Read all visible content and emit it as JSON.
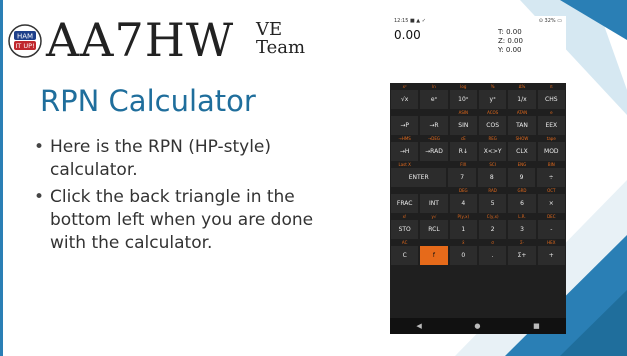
{
  "slide": {
    "brand_main": "AA7HW",
    "brand_sup": "VE",
    "brand_sub": "Team",
    "logo_text_top": "HAM",
    "logo_text_bottom": "IT UP!",
    "title": "RPN Calculator",
    "bullets": [
      "Here is the RPN (HP-style) calculator.",
      "Click the back triangle in the bottom left when you are done with the calculator."
    ],
    "accent_color": "#1f6e9c"
  },
  "phone": {
    "status_left": "12:15 ■ ▲ ✓",
    "status_right": "⊙ 32% ▭",
    "display": {
      "x": "0.00",
      "t": "T: 0.00",
      "z": "Z: 0.00",
      "y": "Y: 0.00"
    },
    "rows": [
      {
        "labels": [
          "x²",
          "ln",
          "log",
          "%",
          "Δ%",
          "π"
        ],
        "keys": [
          "√x",
          "eˣ",
          "10ˣ",
          "yˣ",
          "1/x",
          "CHS"
        ]
      },
      {
        "labels": [
          "",
          "",
          "ASIN",
          "ACOS",
          "ATAN",
          "e"
        ],
        "keys": [
          "→P",
          "→R",
          "SIN",
          "COS",
          "TAN",
          "EEX"
        ]
      },
      {
        "labels": [
          "→HMS",
          "→DEG",
          "cE",
          "REG",
          "SHOW",
          "tape"
        ],
        "keys": [
          "→H",
          "→RAD",
          "R↓",
          "X<>Y",
          "CLX",
          "MOD"
        ]
      },
      {
        "labels": [
          "Last X",
          "",
          "FIX",
          "SCI",
          "ENG",
          "BIN"
        ],
        "keys": [
          "ENTER",
          "",
          "7",
          "8",
          "9",
          "÷"
        ]
      },
      {
        "labels": [
          "",
          "",
          "DEG",
          "RAD",
          "GRD",
          "OCT"
        ],
        "keys": [
          "FRAC",
          "INT",
          "4",
          "5",
          "6",
          "×"
        ]
      },
      {
        "labels": [
          "x!",
          "y√",
          "P(y,x)",
          "C(y,x)",
          "L.R.",
          "DEC"
        ],
        "keys": [
          "STO",
          "RCL",
          "1",
          "2",
          "3",
          "-"
        ]
      },
      {
        "labels": [
          "AC",
          "",
          "x̄",
          "σ",
          "Σ-",
          "HEX"
        ],
        "keys": [
          "C",
          "f",
          "0",
          ".",
          "Σ+",
          "+"
        ]
      }
    ],
    "nav": [
      "◀",
      "●",
      "■"
    ]
  }
}
